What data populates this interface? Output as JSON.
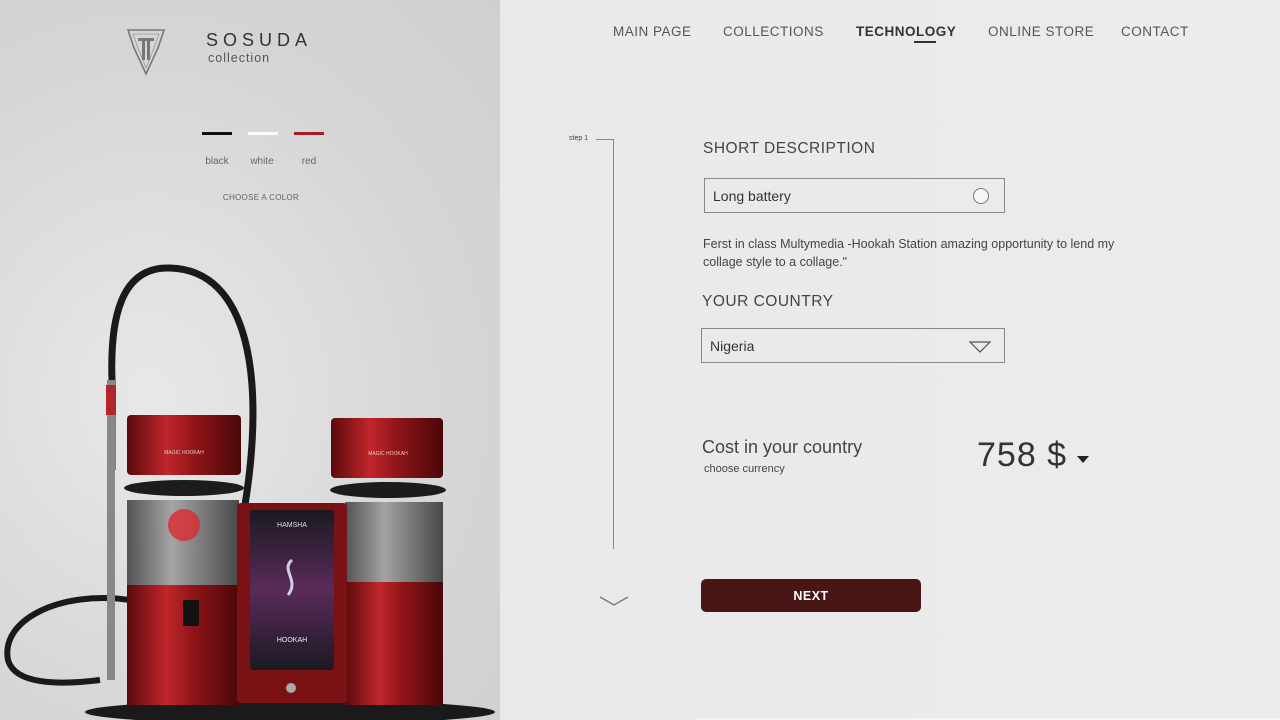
{
  "brand": {
    "name": "SOSUDA",
    "sub": "collection"
  },
  "nav": [
    {
      "label": "MAIN PAGE",
      "active": false
    },
    {
      "label": "COLLECTIONS",
      "active": false
    },
    {
      "label": "TECHNOLOGY",
      "active": true
    },
    {
      "label": "ONLINE STORE",
      "active": false
    },
    {
      "label": "CONTACT",
      "active": false
    }
  ],
  "colors": {
    "options": [
      {
        "label": "black",
        "hex": "#111111"
      },
      {
        "label": "white",
        "hex": "#ffffff"
      },
      {
        "label": "red",
        "hex": "#a51c22"
      }
    ],
    "choose_label": "CHOOSE A COLOR"
  },
  "step": {
    "label": "step 1"
  },
  "form": {
    "short_description": {
      "title": "SHORT DESCRIPTION",
      "value": "Long battery",
      "text": "Ferst in class Multymedia -Hookah Station amazing opportunity  to  lend my  collage  style to a  collage.\""
    },
    "country": {
      "title": "YOUR COUNTRY",
      "value": "Nigeria"
    },
    "cost": {
      "label": "Cost in your country",
      "currency_label": "choose currency",
      "price": "758 $"
    },
    "next_label": "NEXT"
  },
  "product": {
    "screen_title": "HAMSHA",
    "screen_label": "HOOKAH",
    "cup_label": "MAGIC HOOKAH",
    "accent": "#a51c22"
  }
}
